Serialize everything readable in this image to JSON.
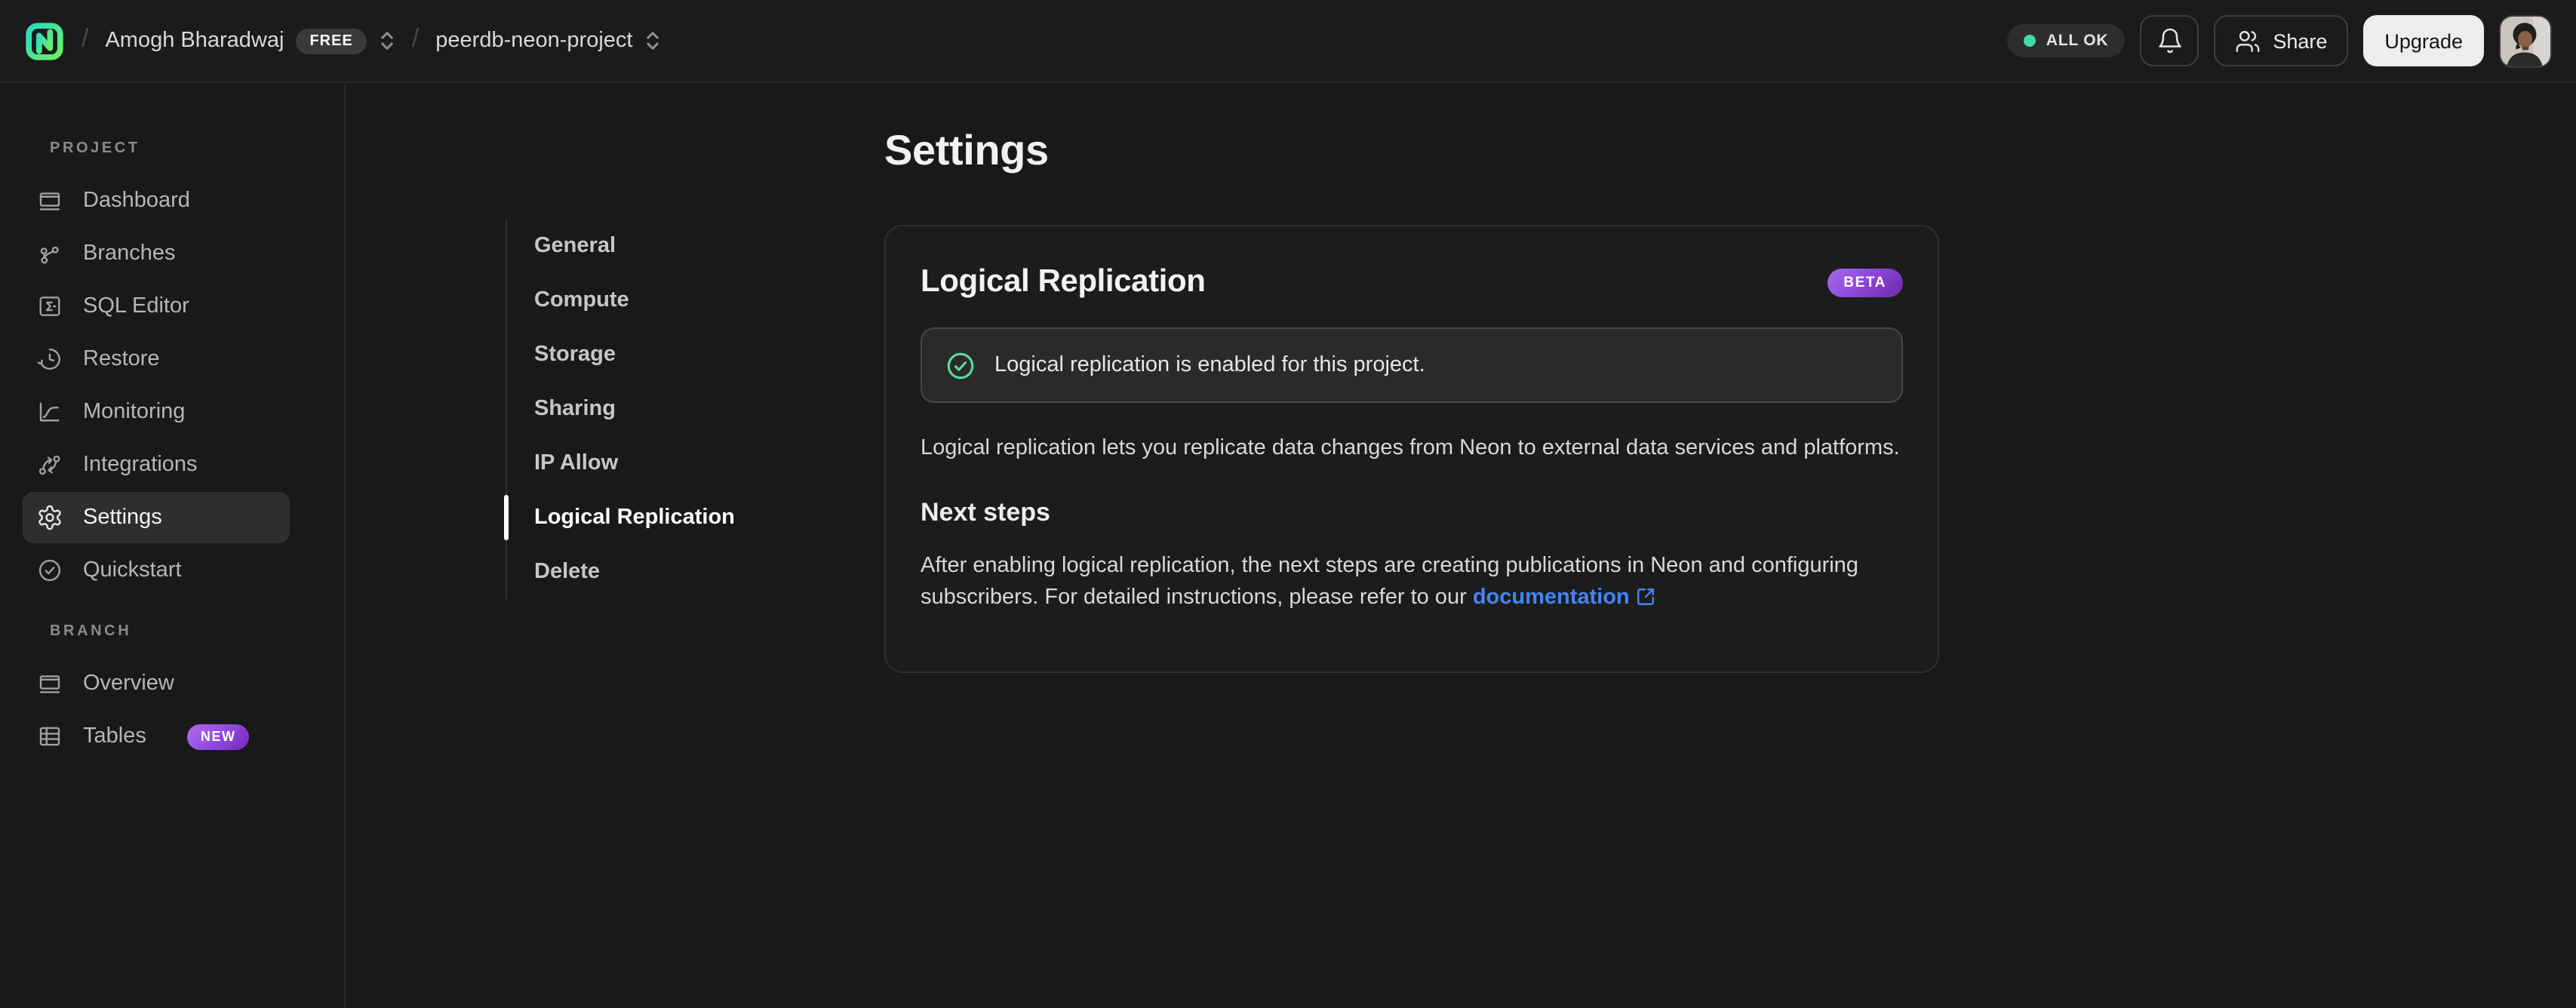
{
  "topbar": {
    "org_name": "Amogh Bharadwaj",
    "org_badge": "FREE",
    "project_name": "peerdb-neon-project",
    "status_label": "ALL OK",
    "share_label": "Share",
    "upgrade_label": "Upgrade"
  },
  "sidebar": {
    "sections": [
      {
        "label": "PROJECT",
        "items": [
          {
            "label": "Dashboard"
          },
          {
            "label": "Branches"
          },
          {
            "label": "SQL Editor"
          },
          {
            "label": "Restore"
          },
          {
            "label": "Monitoring"
          },
          {
            "label": "Integrations"
          },
          {
            "label": "Settings",
            "active": true
          },
          {
            "label": "Quickstart"
          }
        ]
      },
      {
        "label": "BRANCH",
        "items": [
          {
            "label": "Overview"
          },
          {
            "label": "Tables",
            "badge": "NEW"
          }
        ]
      }
    ]
  },
  "settings_nav": {
    "items": [
      {
        "label": "General"
      },
      {
        "label": "Compute"
      },
      {
        "label": "Storage"
      },
      {
        "label": "Sharing"
      },
      {
        "label": "IP Allow"
      },
      {
        "label": "Logical Replication",
        "active": true
      },
      {
        "label": "Delete"
      }
    ]
  },
  "main": {
    "page_title": "Settings",
    "card": {
      "title": "Logical Replication",
      "beta_badge": "BETA",
      "alert_text": "Logical replication is enabled for this project.",
      "description": "Logical replication lets you replicate data changes from Neon to external data services and platforms.",
      "next_steps_title": "Next steps",
      "next_steps_text": "After enabling logical replication, the next steps are creating publications in Neon and configuring subscribers. For detailed instructions, please refer to our ",
      "doc_link_label": "documentation"
    }
  },
  "colors": {
    "accent_green": "#43d9a3",
    "badge_purple": "#8b46d9",
    "link_blue": "#4285f4",
    "background": "#191919"
  }
}
